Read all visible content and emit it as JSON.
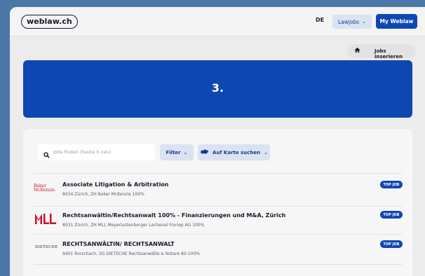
{
  "header": {
    "logo_text": "weblaw.ch",
    "language": "DE",
    "lawjobs_label": "Lawjobs",
    "my_weblaw_label": "My Weblaw"
  },
  "insert_button": {
    "label": "Jobs inserieren",
    "icon": "home-icon"
  },
  "hero": {
    "text": "3."
  },
  "search": {
    "placeholder": "Jobs finden (heute 5 neu)",
    "icon": "search-icon"
  },
  "filters": {
    "filter_label": "Filter",
    "map_label": "Auf Karte suchen",
    "map_icon": "switzerland-map-icon"
  },
  "jobs": [
    {
      "company_logo": "Baker McKenzie.",
      "company_logo_lines": [
        "Baker",
        "McKenzie."
      ],
      "title": "Associate Litigation & Arbitration",
      "meta": "8034 Zürich, ZH    Baker McKenzie    100%",
      "badge": "TOP JOB"
    },
    {
      "company_logo": "MLL",
      "title": "Rechtsanwältin/Rechtsanwalt 100% - Finanzierungen und M&A, Zürich",
      "meta": "8031 Zürich, ZH    MLL Meyerlustenberger Lachenal Froriep AG    100%",
      "badge": "TOP JOB"
    },
    {
      "company_logo": "DIETSCHE",
      "title": "RECHTSANWÄLTIN/ RECHTSANWALT",
      "meta": "9401 Rorschach, SG    DIETSCHE Rechtsanwälte & Notare    80-100%",
      "badge": "TOP JOB"
    }
  ],
  "colors": {
    "brand_blue": "#0f47b2",
    "light_blue": "#d9e3f2",
    "logo_red": "#c8102e",
    "background": "#4a77a6"
  }
}
